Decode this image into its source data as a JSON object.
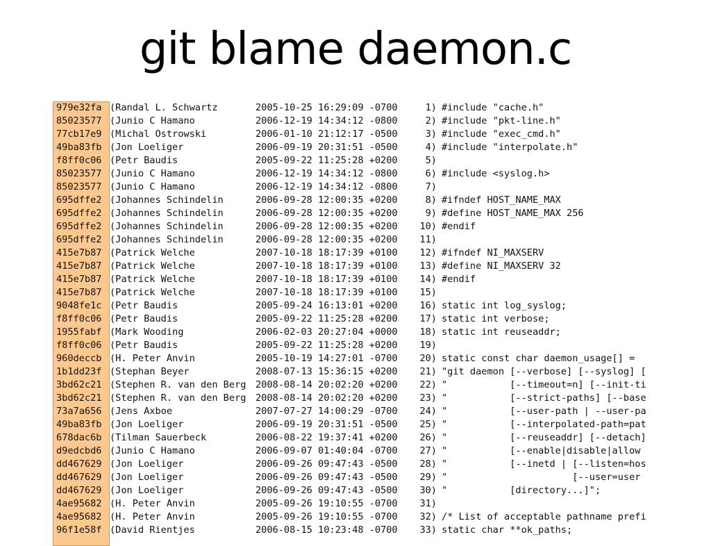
{
  "title": "git blame daemon.c",
  "rows": [
    {
      "hash": "979e32fa",
      "author": "(Randal L. Schwartz",
      "date": "2005-10-25 16:29:09 -0700",
      "line": "1)",
      "code": "#include \"cache.h\""
    },
    {
      "hash": "85023577",
      "author": "(Junio C Hamano",
      "date": "2006-12-19 14:34:12 -0800",
      "line": "2)",
      "code": "#include \"pkt-line.h\""
    },
    {
      "hash": "77cb17e9",
      "author": "(Michal Ostrowski",
      "date": "2006-01-10 21:12:17 -0500",
      "line": "3)",
      "code": "#include \"exec_cmd.h\""
    },
    {
      "hash": "49ba83fb",
      "author": "(Jon Loeliger",
      "date": "2006-09-19 20:31:51 -0500",
      "line": "4)",
      "code": "#include \"interpolate.h\""
    },
    {
      "hash": "f8ff0c06",
      "author": "(Petr Baudis",
      "date": "2005-09-22 11:25:28 +0200",
      "line": "5)",
      "code": ""
    },
    {
      "hash": "85023577",
      "author": "(Junio C Hamano",
      "date": "2006-12-19 14:34:12 -0800",
      "line": "6)",
      "code": "#include <syslog.h>"
    },
    {
      "hash": "85023577",
      "author": "(Junio C Hamano",
      "date": "2006-12-19 14:34:12 -0800",
      "line": "7)",
      "code": ""
    },
    {
      "hash": "695dffe2",
      "author": "(Johannes Schindelin",
      "date": "2006-09-28 12:00:35 +0200",
      "line": "8)",
      "code": "#ifndef HOST_NAME_MAX"
    },
    {
      "hash": "695dffe2",
      "author": "(Johannes Schindelin",
      "date": "2006-09-28 12:00:35 +0200",
      "line": "9)",
      "code": "#define HOST_NAME_MAX 256"
    },
    {
      "hash": "695dffe2",
      "author": "(Johannes Schindelin",
      "date": "2006-09-28 12:00:35 +0200",
      "line": "10)",
      "code": "#endif"
    },
    {
      "hash": "695dffe2",
      "author": "(Johannes Schindelin",
      "date": "2006-09-28 12:00:35 +0200",
      "line": "11)",
      "code": ""
    },
    {
      "hash": "415e7b87",
      "author": "(Patrick Welche",
      "date": "2007-10-18 18:17:39 +0100",
      "line": "12)",
      "code": "#ifndef NI_MAXSERV"
    },
    {
      "hash": "415e7b87",
      "author": "(Patrick Welche",
      "date": "2007-10-18 18:17:39 +0100",
      "line": "13)",
      "code": "#define NI_MAXSERV 32"
    },
    {
      "hash": "415e7b87",
      "author": "(Patrick Welche",
      "date": "2007-10-18 18:17:39 +0100",
      "line": "14)",
      "code": "#endif"
    },
    {
      "hash": "415e7b87",
      "author": "(Patrick Welche",
      "date": "2007-10-18 18:17:39 +0100",
      "line": "15)",
      "code": ""
    },
    {
      "hash": "9048fe1c",
      "author": "(Petr Baudis",
      "date": "2005-09-24 16:13:01 +0200",
      "line": "16)",
      "code": "static int log_syslog;"
    },
    {
      "hash": "f8ff0c06",
      "author": "(Petr Baudis",
      "date": "2005-09-22 11:25:28 +0200",
      "line": "17)",
      "code": "static int verbose;"
    },
    {
      "hash": "1955fabf",
      "author": "(Mark Wooding",
      "date": "2006-02-03 20:27:04 +0000",
      "line": "18)",
      "code": "static int reuseaddr;"
    },
    {
      "hash": "f8ff0c06",
      "author": "(Petr Baudis",
      "date": "2005-09-22 11:25:28 +0200",
      "line": "19)",
      "code": ""
    },
    {
      "hash": "960deccb",
      "author": "(H. Peter Anvin",
      "date": "2005-10-19 14:27:01 -0700",
      "line": "20)",
      "code": "static const char daemon_usage[] ="
    },
    {
      "hash": "1b1dd23f",
      "author": "(Stephan Beyer",
      "date": "2008-07-13 15:36:15 +0200",
      "line": "21)",
      "code": "\"git daemon [--verbose] [--syslog] ["
    },
    {
      "hash": "3bd62c21",
      "author": "(Stephen R. van den Berg",
      "date": "2008-08-14 20:02:20 +0200",
      "line": "22)",
      "code": "\"           [--timeout=n] [--init-ti"
    },
    {
      "hash": "3bd62c21",
      "author": "(Stephen R. van den Berg",
      "date": "2008-08-14 20:02:20 +0200",
      "line": "23)",
      "code": "\"           [--strict-paths] [--base"
    },
    {
      "hash": "73a7a656",
      "author": "(Jens Axboe",
      "date": "2007-07-27 14:00:29 -0700",
      "line": "24)",
      "code": "\"           [--user-path | --user-pa"
    },
    {
      "hash": "49ba83fb",
      "author": "(Jon Loeliger",
      "date": "2006-09-19 20:31:51 -0500",
      "line": "25)",
      "code": "\"           [--interpolated-path=pat"
    },
    {
      "hash": "678dac6b",
      "author": "(Tilman Sauerbeck",
      "date": "2006-08-22 19:37:41 +0200",
      "line": "26)",
      "code": "\"           [--reuseaddr] [--detach]"
    },
    {
      "hash": "d9edcbd6",
      "author": "(Junio C Hamano",
      "date": "2006-09-07 01:40:04 -0700",
      "line": "27)",
      "code": "\"           [--enable|disable|allow"
    },
    {
      "hash": "dd467629",
      "author": "(Jon Loeliger",
      "date": "2006-09-26 09:47:43 -0500",
      "line": "28)",
      "code": "\"           [--inetd | [--listen=hos"
    },
    {
      "hash": "dd467629",
      "author": "(Jon Loeliger",
      "date": "2006-09-26 09:47:43 -0500",
      "line": "29)",
      "code": "\"                      [--user=user"
    },
    {
      "hash": "dd467629",
      "author": "(Jon Loeliger",
      "date": "2006-09-26 09:47:43 -0500",
      "line": "30)",
      "code": "\"           [directory...]\";"
    },
    {
      "hash": "4ae95682",
      "author": "(H. Peter Anvin",
      "date": "2005-09-26 19:10:55 -0700",
      "line": "31)",
      "code": ""
    },
    {
      "hash": "4ae95682",
      "author": "(H. Peter Anvin",
      "date": "2005-09-26 19:10:55 -0700",
      "line": "32)",
      "code": "/* List of acceptable pathname prefi"
    },
    {
      "hash": "96f1e58f",
      "author": "(David Rientjes",
      "date": "2006-08-15 10:23:48 -0700",
      "line": "33)",
      "code": "static char **ok_paths;"
    }
  ]
}
